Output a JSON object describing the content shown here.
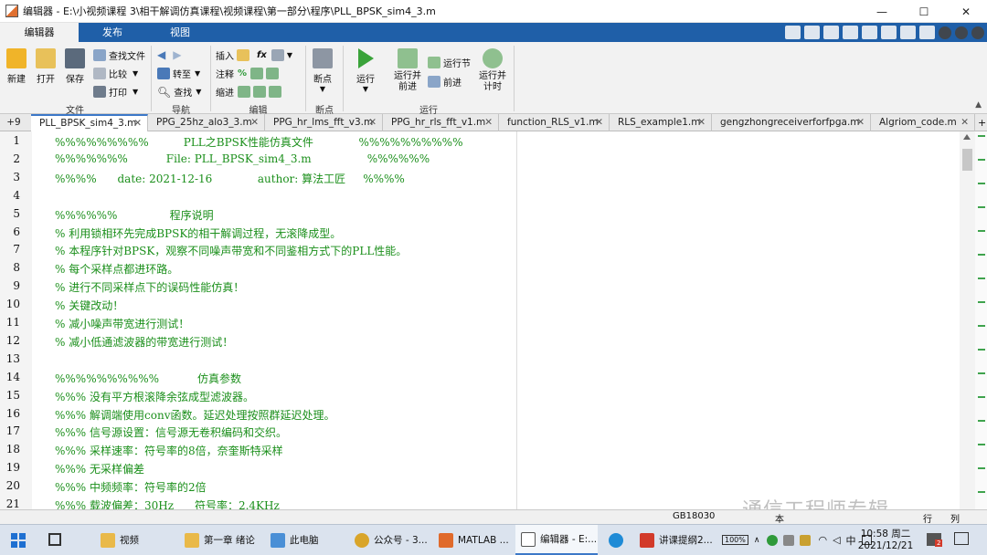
{
  "window": {
    "title": "编辑器 - E:\\小视频课程 3\\相干解调仿真课程\\视频课程\\第一部分\\程序\\PLL_BPSK_sim4_3.m",
    "controls": [
      "—",
      "☐",
      "✕"
    ]
  },
  "ribbon": {
    "tabs": [
      "编辑器",
      "发布",
      "视图"
    ],
    "groups": {
      "file": {
        "label": "文件",
        "new": "新建",
        "open": "打开",
        "save": "保存",
        "find_files": "查找文件",
        "compare": "比较",
        "print": "打印"
      },
      "navigate": {
        "label": "导航",
        "goto": "转至",
        "find": "查找"
      },
      "edit": {
        "label": "编辑",
        "insert": "插入",
        "comment": "注释",
        "indent": "缩进",
        "fx": "fx",
        "percent": "%"
      },
      "breakpoints": {
        "label": "断点",
        "breakpoints": "断点"
      },
      "run": {
        "label": "运行",
        "run": "运行",
        "run_advance": "运行并\n前进",
        "run_section": "运行节",
        "advance": "前进",
        "run_time": "运行并\n计时"
      }
    }
  },
  "file_tabs": {
    "overflow": "+9",
    "tabs": [
      "PLL_BPSK_sim4_3.m",
      "PPG_25hz_alo3_3.m",
      "PPG_hr_lms_fft_v3.m",
      "PPG_hr_rls_fft_v1.m",
      "function_RLS_v1.m",
      "RLS_example1.m",
      "gengzhongreceiverforfpga.m",
      "Algriom_code.m"
    ]
  },
  "code_lines": [
    {
      "n": "1",
      "text": "%%%%%%%%%          PLL之BPSK性能仿真文件             %%%%%%%%%%"
    },
    {
      "n": "2",
      "text": "%%%%%%%           File: PLL_BPSK_sim4_3.m                %%%%%%"
    },
    {
      "n": "3",
      "text": "%%%%      date: 2021-12-16             author: 算法工匠     %%%%"
    },
    {
      "n": "4",
      "text": ""
    },
    {
      "n": "5",
      "text": "%%%%%%               程序说明"
    },
    {
      "n": "6",
      "text": "% 利用锁相环先完成BPSK的相干解调过程，无滚降成型。"
    },
    {
      "n": "7",
      "text": "% 本程序针对BPSK，观察不同噪声带宽和不同鉴相方式下的PLL性能。"
    },
    {
      "n": "8",
      "text": "% 每个采样点都进环路。"
    },
    {
      "n": "9",
      "text": "% 进行不同采样点下的误码性能仿真！"
    },
    {
      "n": "10",
      "text": "% 关键改动！"
    },
    {
      "n": "11",
      "text": "% 减小噪声带宽进行测试！"
    },
    {
      "n": "12",
      "text": "% 减小低通滤波器的带宽进行测试！"
    },
    {
      "n": "13",
      "text": ""
    },
    {
      "n": "14",
      "text": "%%%%%%%%%%           仿真参数"
    },
    {
      "n": "15",
      "text": "%%% 没有平方根滚降余弦成型滤波器。"
    },
    {
      "n": "16",
      "text": "%%% 解调端使用conv函数。延迟处理按照群延迟处理。"
    },
    {
      "n": "17",
      "text": "%%% 信号源设置：信号源无卷积编码和交织。"
    },
    {
      "n": "18",
      "text": "%%% 采样速率：符号率的8倍，奈奎斯特采样"
    },
    {
      "n": "19",
      "text": "%%% 无采样偏差"
    },
    {
      "n": "20",
      "text": "%%% 中频频率：符号率的2倍"
    },
    {
      "n": "21",
      "text": "%%% 载波偏差：30Hz      符号率：2.4KHz"
    }
  ],
  "status": {
    "encoding": "GB18030",
    "script_mode": "本",
    "row": "行",
    "col": "列"
  },
  "watermark": "通信工程师专辑",
  "taskbar": {
    "items": [
      "视频",
      "第一章 绪论",
      "此电脑",
      "公众号 - 3...",
      "MATLAB ...",
      "编辑器 - E:...",
      "",
      "讲课提纲2..."
    ],
    "battery": "100%",
    "lang": "中",
    "time": "10:58 周二",
    "date": "2021/12/21",
    "notif_count": "2"
  },
  "colors": {
    "ribbon_blue": "#1f5fa8",
    "comment_green": "#1b8f1b",
    "taskbar": "#dbe3ee"
  }
}
